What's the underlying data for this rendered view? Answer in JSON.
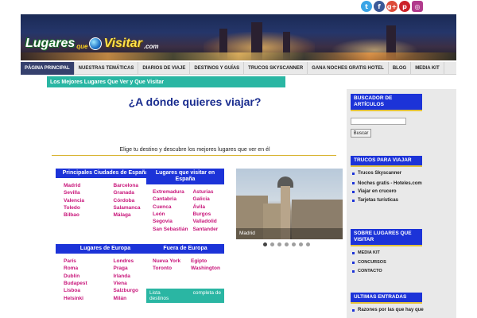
{
  "social": {
    "icons": [
      {
        "name": "twitter-icon",
        "glyph": "t",
        "color": "#3aa4e6"
      },
      {
        "name": "facebook-icon",
        "glyph": "f",
        "color": "#3b5998"
      },
      {
        "name": "google-plus-icon",
        "glyph": "g+",
        "color": "#dd4b39"
      },
      {
        "name": "pinterest-icon",
        "glyph": "p",
        "color": "#cb2027"
      },
      {
        "name": "instagram-icon",
        "glyph": "◎",
        "color": "#b13a8c"
      }
    ]
  },
  "logo": {
    "part1": "Lugares",
    "part2": "que",
    "part3": "Visitar",
    "part4": ".com"
  },
  "nav": {
    "items": [
      {
        "label": "PÁGINA PRINCIPAL",
        "active": true
      },
      {
        "label": "NUESTRAS TEMÁTICAS",
        "active": false
      },
      {
        "label": "DIARIOS DE VIAJE",
        "active": false
      },
      {
        "label": "DESTINOS Y GUÍAS",
        "active": false
      },
      {
        "label": "TRUCOS SKYSCANNER",
        "active": false
      },
      {
        "label": "GANA NOCHES GRATIS HOTEL",
        "active": false
      },
      {
        "label": "BLOG",
        "active": false
      },
      {
        "label": "MEDIA KIT",
        "active": false
      }
    ]
  },
  "page": {
    "section_title": "Los Mejores Lugares Que Ver y Que Visitar",
    "headline": "¿A dónde quieres viajar?",
    "subline": "Elige tu destino y descubre los mejores lugares que ver en él"
  },
  "boxes": {
    "espana": {
      "title": "Principales Ciudades de España",
      "col1": [
        "Madrid",
        "Sevilla",
        "Valencia",
        "Toledo",
        "Bilbao"
      ],
      "col2": [
        "Barcelona",
        "Granada",
        "Córdoba",
        "Salamanca",
        "Málaga"
      ]
    },
    "visitar_espana": {
      "title": "Lugares que visitar en España",
      "col1": [
        "Extremadura",
        "Cantabria",
        "Cuenca",
        "León",
        "Segovia",
        "San Sebastián"
      ],
      "col2": [
        "Asturias",
        "Galicia",
        "Ávila",
        "Burgos",
        "Valladolid",
        "Santander"
      ]
    },
    "europa": {
      "title": "Lugares de Europa",
      "col1": [
        "París",
        "Roma",
        "Dublín",
        "Budapest",
        "Lisboa",
        "Helsinki"
      ],
      "col2": [
        "Londres",
        "Praga",
        "Irlanda",
        "Viena",
        "Salzburgo",
        "Milán"
      ]
    },
    "fuera_europa": {
      "title": "Fuera de Europa",
      "col1": [
        "Nueva York",
        "Toronto"
      ],
      "col2": [
        "Egipto",
        "Washington"
      ]
    },
    "list_button": {
      "line1a": "Lista",
      "line1b": "completa de",
      "line2": "destinos"
    }
  },
  "slider": {
    "caption": "Madrid",
    "total_dots": 7,
    "active_dot": 0
  },
  "sidebar": {
    "search": {
      "title": "BUSCADOR DE ARTÍCULOS",
      "input_value": "",
      "button": "Buscar"
    },
    "tricks": {
      "title": "TRUCOS PARA VIAJAR",
      "items": [
        "Trucos Skyscanner",
        "Noches gratis - Hoteles.com",
        "Viajar en crucero",
        "Tarjetas turísticas"
      ]
    },
    "about": {
      "title": "SOBRE LUGARES QUE VISITAR",
      "items": [
        "MEDIA KIT",
        "CONCURSOS",
        "CONTACTO"
      ]
    },
    "latest": {
      "title": "ULTIMAS ENTRADAS",
      "items": [
        "Razones por las que hay que"
      ]
    }
  }
}
